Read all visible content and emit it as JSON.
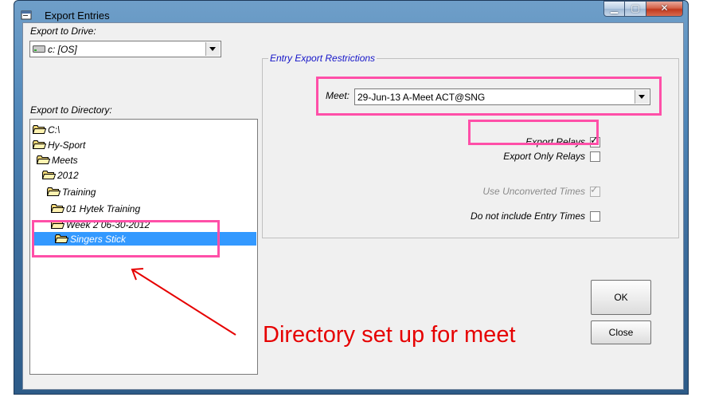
{
  "window": {
    "title": "Export Entries"
  },
  "title_buttons": {
    "minimize": "▁",
    "maximize": "▢",
    "close": "✕"
  },
  "drive": {
    "label": "Export to Drive:",
    "value": "c: [OS]"
  },
  "directory": {
    "label": "Export to Directory:",
    "items": [
      {
        "text": "C:\\"
      },
      {
        "text": "Hy-Sport"
      },
      {
        "text": "Meets"
      },
      {
        "text": "2012"
      },
      {
        "text": "Training"
      },
      {
        "text": "01 Hytek Training"
      },
      {
        "text": "Week 2 06-30-2012"
      },
      {
        "text": "Singers Stick"
      }
    ],
    "selected": "Singers Stick"
  },
  "restrictions": {
    "title": "Entry Export Restrictions",
    "meet_label": "Meet:",
    "meet_value": "29-Jun-13 A-Meet ACT@SNG",
    "export_relays": {
      "label": "Export Relays",
      "checked": true
    },
    "export_only_relays": {
      "label": "Export Only Relays",
      "checked": false
    },
    "use_unconverted_times": {
      "label": "Use Unconverted Times",
      "checked": true,
      "disabled": true
    },
    "no_entry_times": {
      "label": "Do not include Entry Times",
      "checked": false
    }
  },
  "buttons": {
    "ok": "OK",
    "close": "Close"
  },
  "annotation": {
    "text": "Directory set up for meet",
    "color": "#e60000",
    "highlight_color": "#ff4fa8"
  },
  "colors": {
    "selection": "#3399ff",
    "group_title": "#1414c8"
  }
}
